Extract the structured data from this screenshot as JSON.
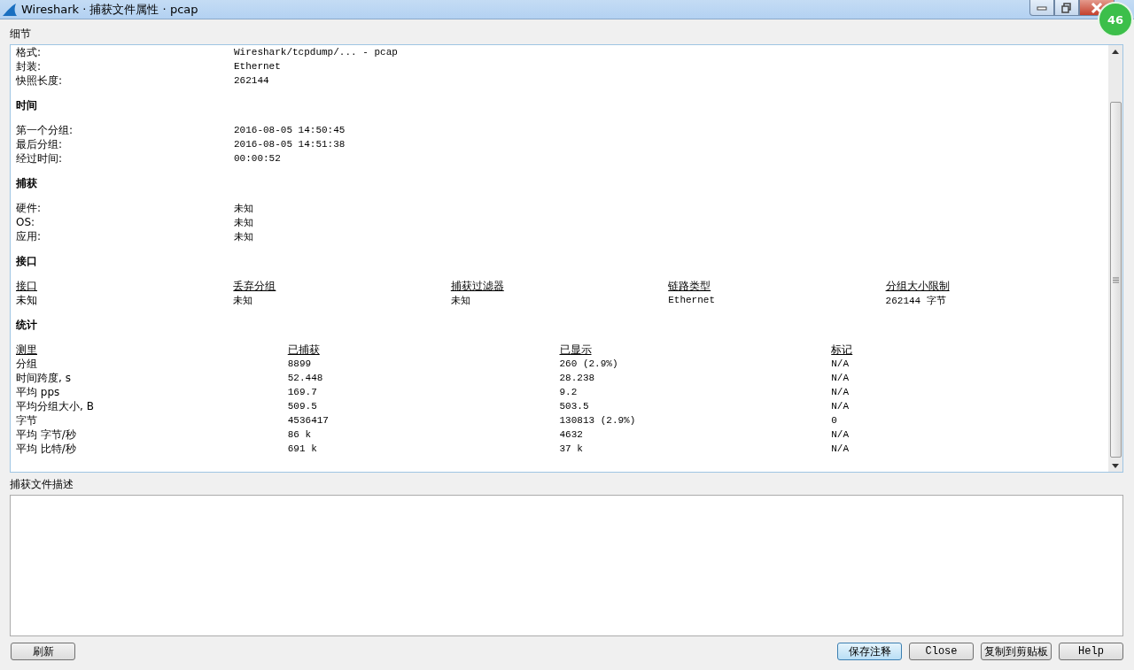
{
  "window": {
    "title": "Wireshark · 捕获文件属性 · pcap",
    "badge": "46"
  },
  "details_label": "细节",
  "sections": [
    {
      "kind": "pairs",
      "rows": [
        {
          "label": "格式:",
          "value": "Wireshark/tcpdump/... - pcap"
        },
        {
          "label": "封装:",
          "value": "Ethernet"
        },
        {
          "label": "快照长度:",
          "value": "262144"
        }
      ]
    },
    {
      "kind": "pairs",
      "title": "时间",
      "rows": [
        {
          "label": "第一个分组:",
          "value": "2016-08-05 14:50:45"
        },
        {
          "label": "最后分组:",
          "value": "2016-08-05 14:51:38"
        },
        {
          "label": "经过时间:",
          "value": "00:00:52"
        }
      ]
    },
    {
      "kind": "pairs",
      "title": "捕获",
      "rows": [
        {
          "label": "硬件:",
          "value": "未知"
        },
        {
          "label": "OS:",
          "value": "未知"
        },
        {
          "label": "应用:",
          "value": "未知"
        }
      ]
    },
    {
      "kind": "table",
      "title": "接口",
      "columns": [
        "接口",
        "丢弃分组",
        "捕获过滤器",
        "链路类型",
        "分组大小限制"
      ],
      "rows": [
        [
          "未知",
          "未知",
          "未知",
          "Ethernet",
          "262144 字节"
        ]
      ]
    },
    {
      "kind": "table",
      "title": "统计",
      "columns": [
        "测里",
        "已捕获",
        "已显示",
        "标记"
      ],
      "rows": [
        [
          "分组",
          "8899",
          "260 (2.9%)",
          "N/A"
        ],
        [
          "时间跨度, s",
          "52.448",
          "28.238",
          "N/A"
        ],
        [
          "平均 pps",
          "169.7",
          "9.2",
          "N/A"
        ],
        [
          "平均分组大小, B",
          "509.5",
          "503.5",
          "N/A"
        ],
        [
          "字节",
          "4536417",
          "130813 (2.9%)",
          "0"
        ],
        [
          "平均 字节/秒",
          "86 k",
          "4632",
          "N/A"
        ],
        [
          "平均 比特/秒",
          "691 k",
          "37 k",
          "N/A"
        ]
      ]
    }
  ],
  "description_label": "捕获文件描述",
  "buttons_left": [
    {
      "label": "刷新",
      "default": false
    }
  ],
  "buttons_right": [
    {
      "label": "保存注释",
      "default": true
    },
    {
      "label": "Close",
      "default": false
    },
    {
      "label": "复制到剪贴板",
      "default": false
    },
    {
      "label": "Help",
      "default": false
    }
  ]
}
